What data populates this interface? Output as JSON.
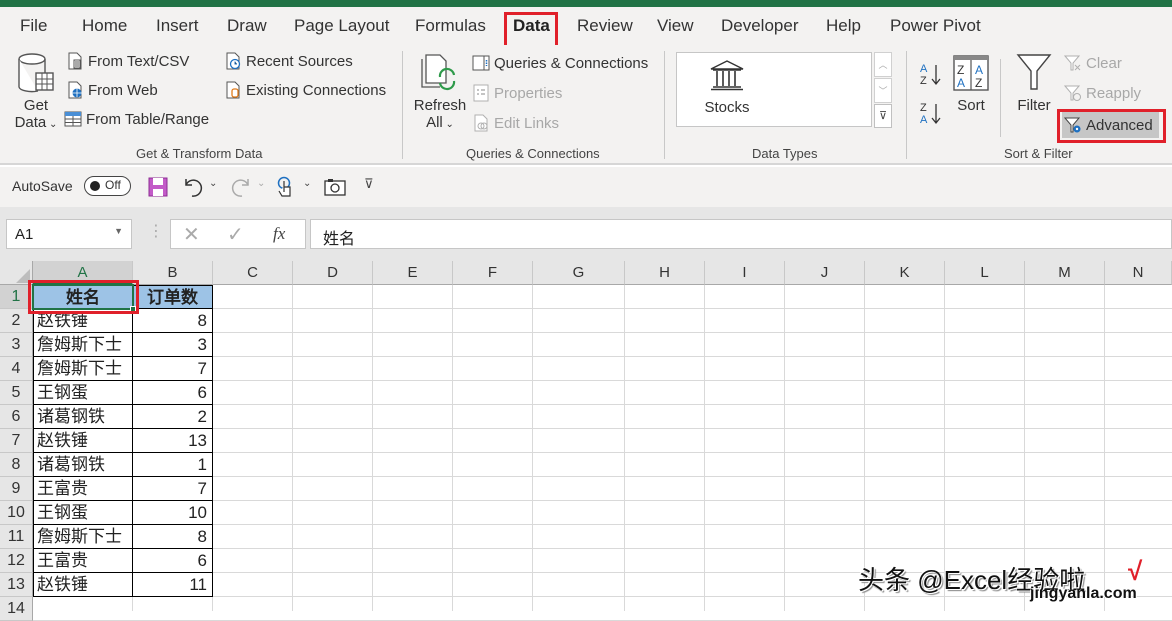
{
  "tabs": [
    {
      "label": "File"
    },
    {
      "label": "Home"
    },
    {
      "label": "Insert"
    },
    {
      "label": "Draw"
    },
    {
      "label": "Page Layout"
    },
    {
      "label": "Formulas"
    },
    {
      "label": "Data",
      "active": true
    },
    {
      "label": "Review"
    },
    {
      "label": "View"
    },
    {
      "label": "Developer"
    },
    {
      "label": "Help"
    },
    {
      "label": "Power Pivot"
    }
  ],
  "ribbon": {
    "get_transform": {
      "get_data_line1": "Get",
      "get_data_line2": "Data",
      "from_text_csv": "From Text/CSV",
      "from_web": "From Web",
      "from_table_range": "From Table/Range",
      "recent_sources": "Recent Sources",
      "existing_connections": "Existing Connections",
      "group_label": "Get & Transform Data"
    },
    "queries": {
      "refresh_line1": "Refresh",
      "refresh_line2": "All",
      "queries_connections": "Queries & Connections",
      "properties": "Properties",
      "edit_links": "Edit Links",
      "group_label": "Queries & Connections"
    },
    "data_types": {
      "stocks": "Stocks",
      "group_label": "Data Types"
    },
    "sort_filter": {
      "sort": "Sort",
      "filter": "Filter",
      "clear": "Clear",
      "reapply": "Reapply",
      "advanced": "Advanced",
      "group_label": "Sort & Filter"
    }
  },
  "qat": {
    "autosave_label": "AutoSave",
    "autosave_state": "Off"
  },
  "formula_bar": {
    "name_box": "A1",
    "formula": "姓名",
    "fx": "fx"
  },
  "sheet": {
    "columns": [
      "A",
      "B",
      "C",
      "D",
      "E",
      "F",
      "G",
      "H",
      "I",
      "J",
      "K",
      "L",
      "M",
      "N"
    ],
    "rows": [
      "1",
      "2",
      "3",
      "4",
      "5",
      "6",
      "7",
      "8",
      "9",
      "10",
      "11",
      "12",
      "13",
      "14"
    ],
    "header": [
      "姓名",
      "订单数"
    ],
    "data": [
      [
        "赵铁锤",
        "8"
      ],
      [
        "詹姆斯下士",
        "3"
      ],
      [
        "詹姆斯下士",
        "7"
      ],
      [
        "王钢蛋",
        "6"
      ],
      [
        "诸葛钢铁",
        "2"
      ],
      [
        "赵铁锤",
        "13"
      ],
      [
        "诸葛钢铁",
        "1"
      ],
      [
        "王富贵",
        "7"
      ],
      [
        "王钢蛋",
        "10"
      ],
      [
        "詹姆斯下士",
        "8"
      ],
      [
        "王富贵",
        "6"
      ],
      [
        "赵铁锤",
        "11"
      ]
    ],
    "selected_cell": "A1",
    "header_fill": "#9dc3e6"
  },
  "watermark": {
    "text": "头条 @Excel经验啦",
    "sub": "jingyanla.com",
    "check": "√"
  },
  "colors": {
    "brand": "#217346",
    "highlight": "#e0202a"
  }
}
